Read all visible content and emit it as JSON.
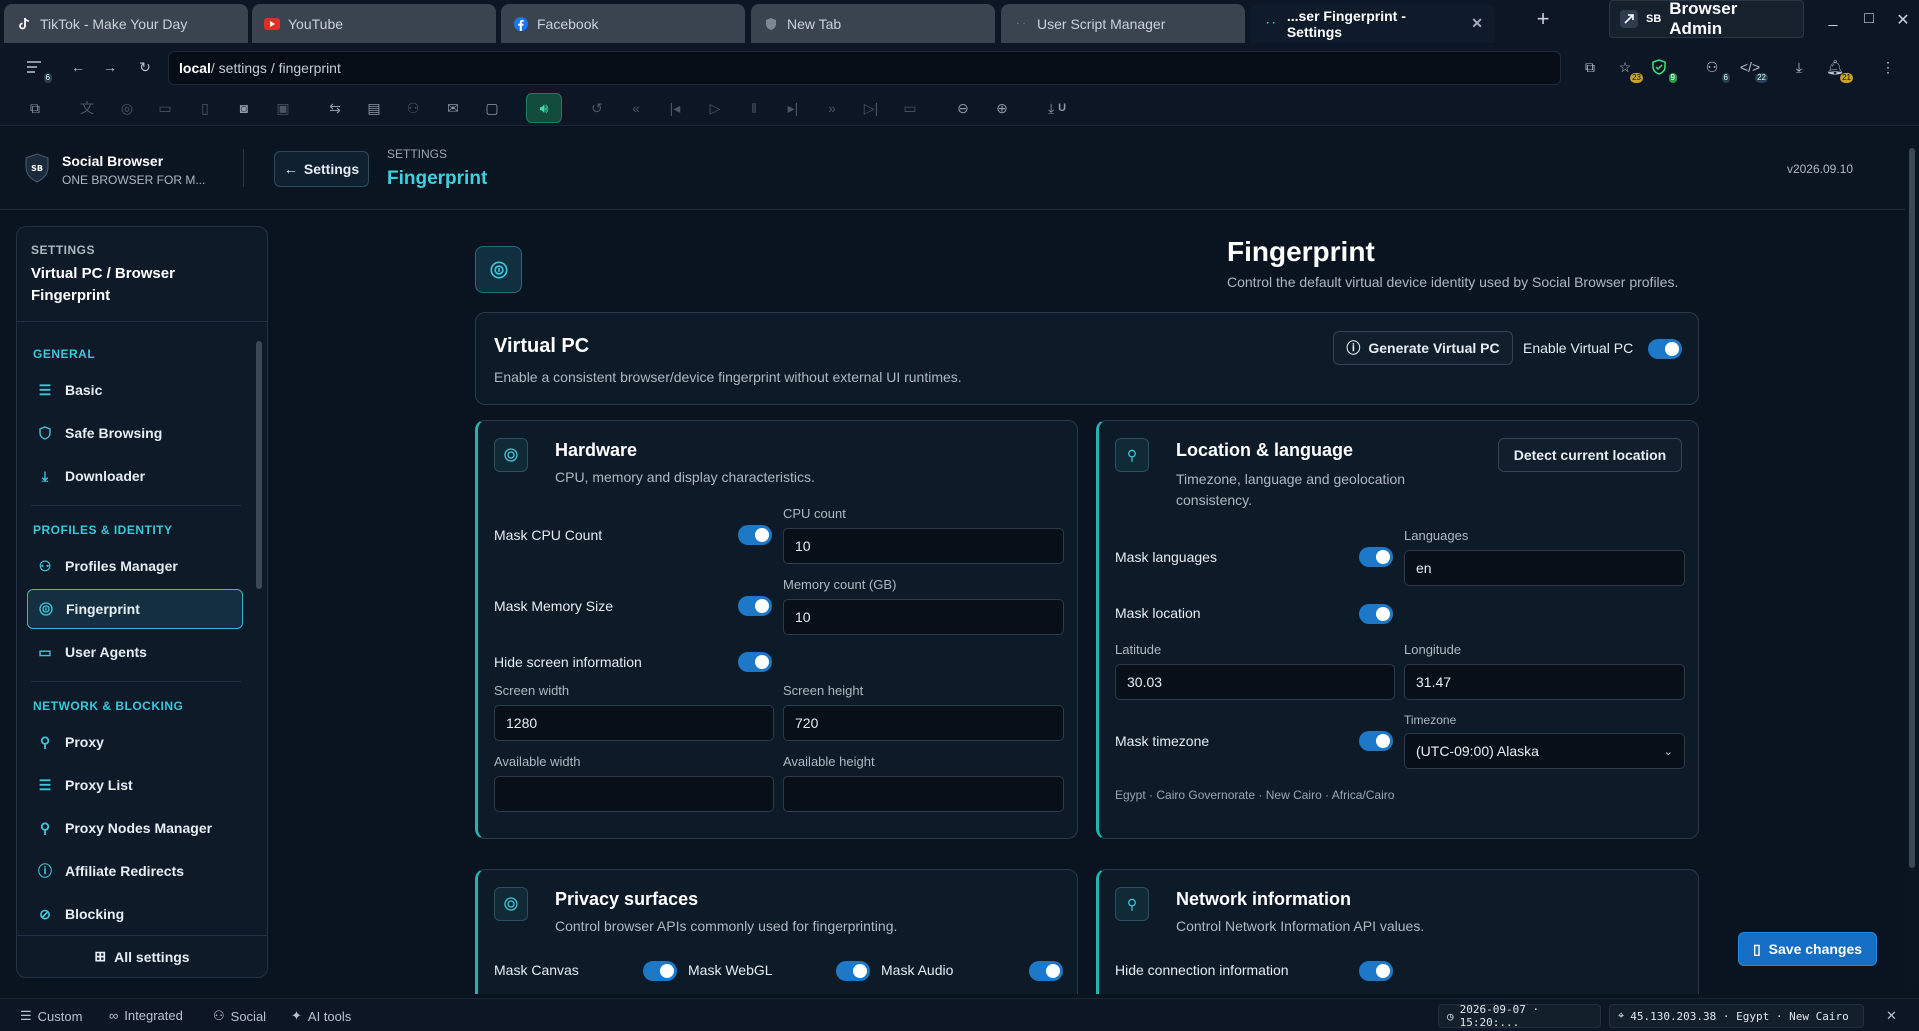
{
  "tabs": [
    {
      "title": "TikTok - Make Your Day",
      "icon": "tiktok-icon"
    },
    {
      "title": "YouTube",
      "icon": "youtube-icon"
    },
    {
      "title": "Facebook",
      "icon": "facebook-icon"
    },
    {
      "title": "New Tab",
      "icon": "shield-icon"
    },
    {
      "title": "User Script Manager",
      "icon": "dots-icon"
    },
    {
      "title": "...ser Fingerprint - Settings",
      "icon": "dots-icon",
      "active": true
    }
  ],
  "admin": {
    "badge": "SB",
    "label": "Browser Admin"
  },
  "address": {
    "host": "local",
    "path": " / settings / fingerprint"
  },
  "toolbar_badges": {
    "star": "23",
    "shield": "9",
    "ext1": "6",
    "ext2": "22",
    "bell": "21",
    "download_label": "U"
  },
  "header": {
    "brand_name": "Social Browser",
    "brand_tagline": "ONE BROWSER FOR M...",
    "back_label": "Settings",
    "crumb": "SETTINGS",
    "crumb_title": "Fingerprint",
    "version": "v2026.09.10"
  },
  "sidebar": {
    "kicker": "SETTINGS",
    "title": "Virtual PC / Browser Fingerprint",
    "sections": [
      {
        "title": "GENERAL",
        "items": [
          "Basic",
          "Safe Browsing",
          "Downloader"
        ]
      },
      {
        "title": "PROFILES & IDENTITY",
        "items": [
          "Profiles Manager",
          "Fingerprint",
          "User Agents"
        ]
      },
      {
        "title": "NETWORK & BLOCKING",
        "items": [
          "Proxy",
          "Proxy List",
          "Proxy Nodes Manager",
          "Affiliate Redirects",
          "Blocking"
        ]
      }
    ],
    "active_item": "Fingerprint",
    "all_settings": "All settings"
  },
  "page": {
    "title": "Fingerprint",
    "subtitle": "Control the default virtual device identity used by Social Browser profiles."
  },
  "virtual_pc": {
    "title": "Virtual PC",
    "subtitle": "Enable a consistent browser/device fingerprint without external UI runtimes.",
    "generate_label": "Generate Virtual PC",
    "enable_label": "Enable Virtual PC",
    "enabled": true
  },
  "hardware": {
    "title": "Hardware",
    "subtitle": "CPU, memory and display characteristics.",
    "mask_cpu_label": "Mask CPU Count",
    "cpu_count_label": "CPU count",
    "cpu_count": "10",
    "mask_memory_label": "Mask Memory Size",
    "memory_label": "Memory count (GB)",
    "memory": "10",
    "hide_screen_label": "Hide screen information",
    "screen_width_label": "Screen width",
    "screen_width": "1280",
    "screen_height_label": "Screen height",
    "screen_height": "720",
    "avail_width_label": "Available width",
    "avail_width": "",
    "avail_height_label": "Available height",
    "avail_height": ""
  },
  "location": {
    "title": "Location & language",
    "subtitle": "Timezone, language and geolocation consistency.",
    "detect_label": "Detect current location",
    "mask_languages_label": "Mask languages",
    "languages_label": "Languages",
    "languages": "en",
    "mask_location_label": "Mask location",
    "latitude_label": "Latitude",
    "latitude": "30.03",
    "longitude_label": "Longitude",
    "longitude": "31.47",
    "mask_timezone_label": "Mask timezone",
    "timezone_label": "Timezone",
    "timezone": "(UTC-09:00) Alaska",
    "detected": "Egypt · Cairo Governorate · New Cairo · Africa/Cairo"
  },
  "privacy": {
    "title": "Privacy surfaces",
    "subtitle": "Control browser APIs commonly used for fingerprinting.",
    "canvas_label": "Mask Canvas",
    "webgl_label": "Mask WebGL",
    "audio_label": "Mask Audio"
  },
  "network": {
    "title": "Network information",
    "subtitle": "Control Network Information API values.",
    "hide_label": "Hide connection information"
  },
  "save_label": "Save changes",
  "status": {
    "items": [
      "Custom",
      "Integrated",
      "Social",
      "AI tools"
    ],
    "datetime": "2026-09-07 · 15:20:...",
    "ip": "45.130.203.38 · Egypt · New Cairo"
  },
  "colors": {
    "accent": "#3ec7d9",
    "toggle": "#1e78c8",
    "save": "#146ec4",
    "bg": "#0a1420"
  }
}
